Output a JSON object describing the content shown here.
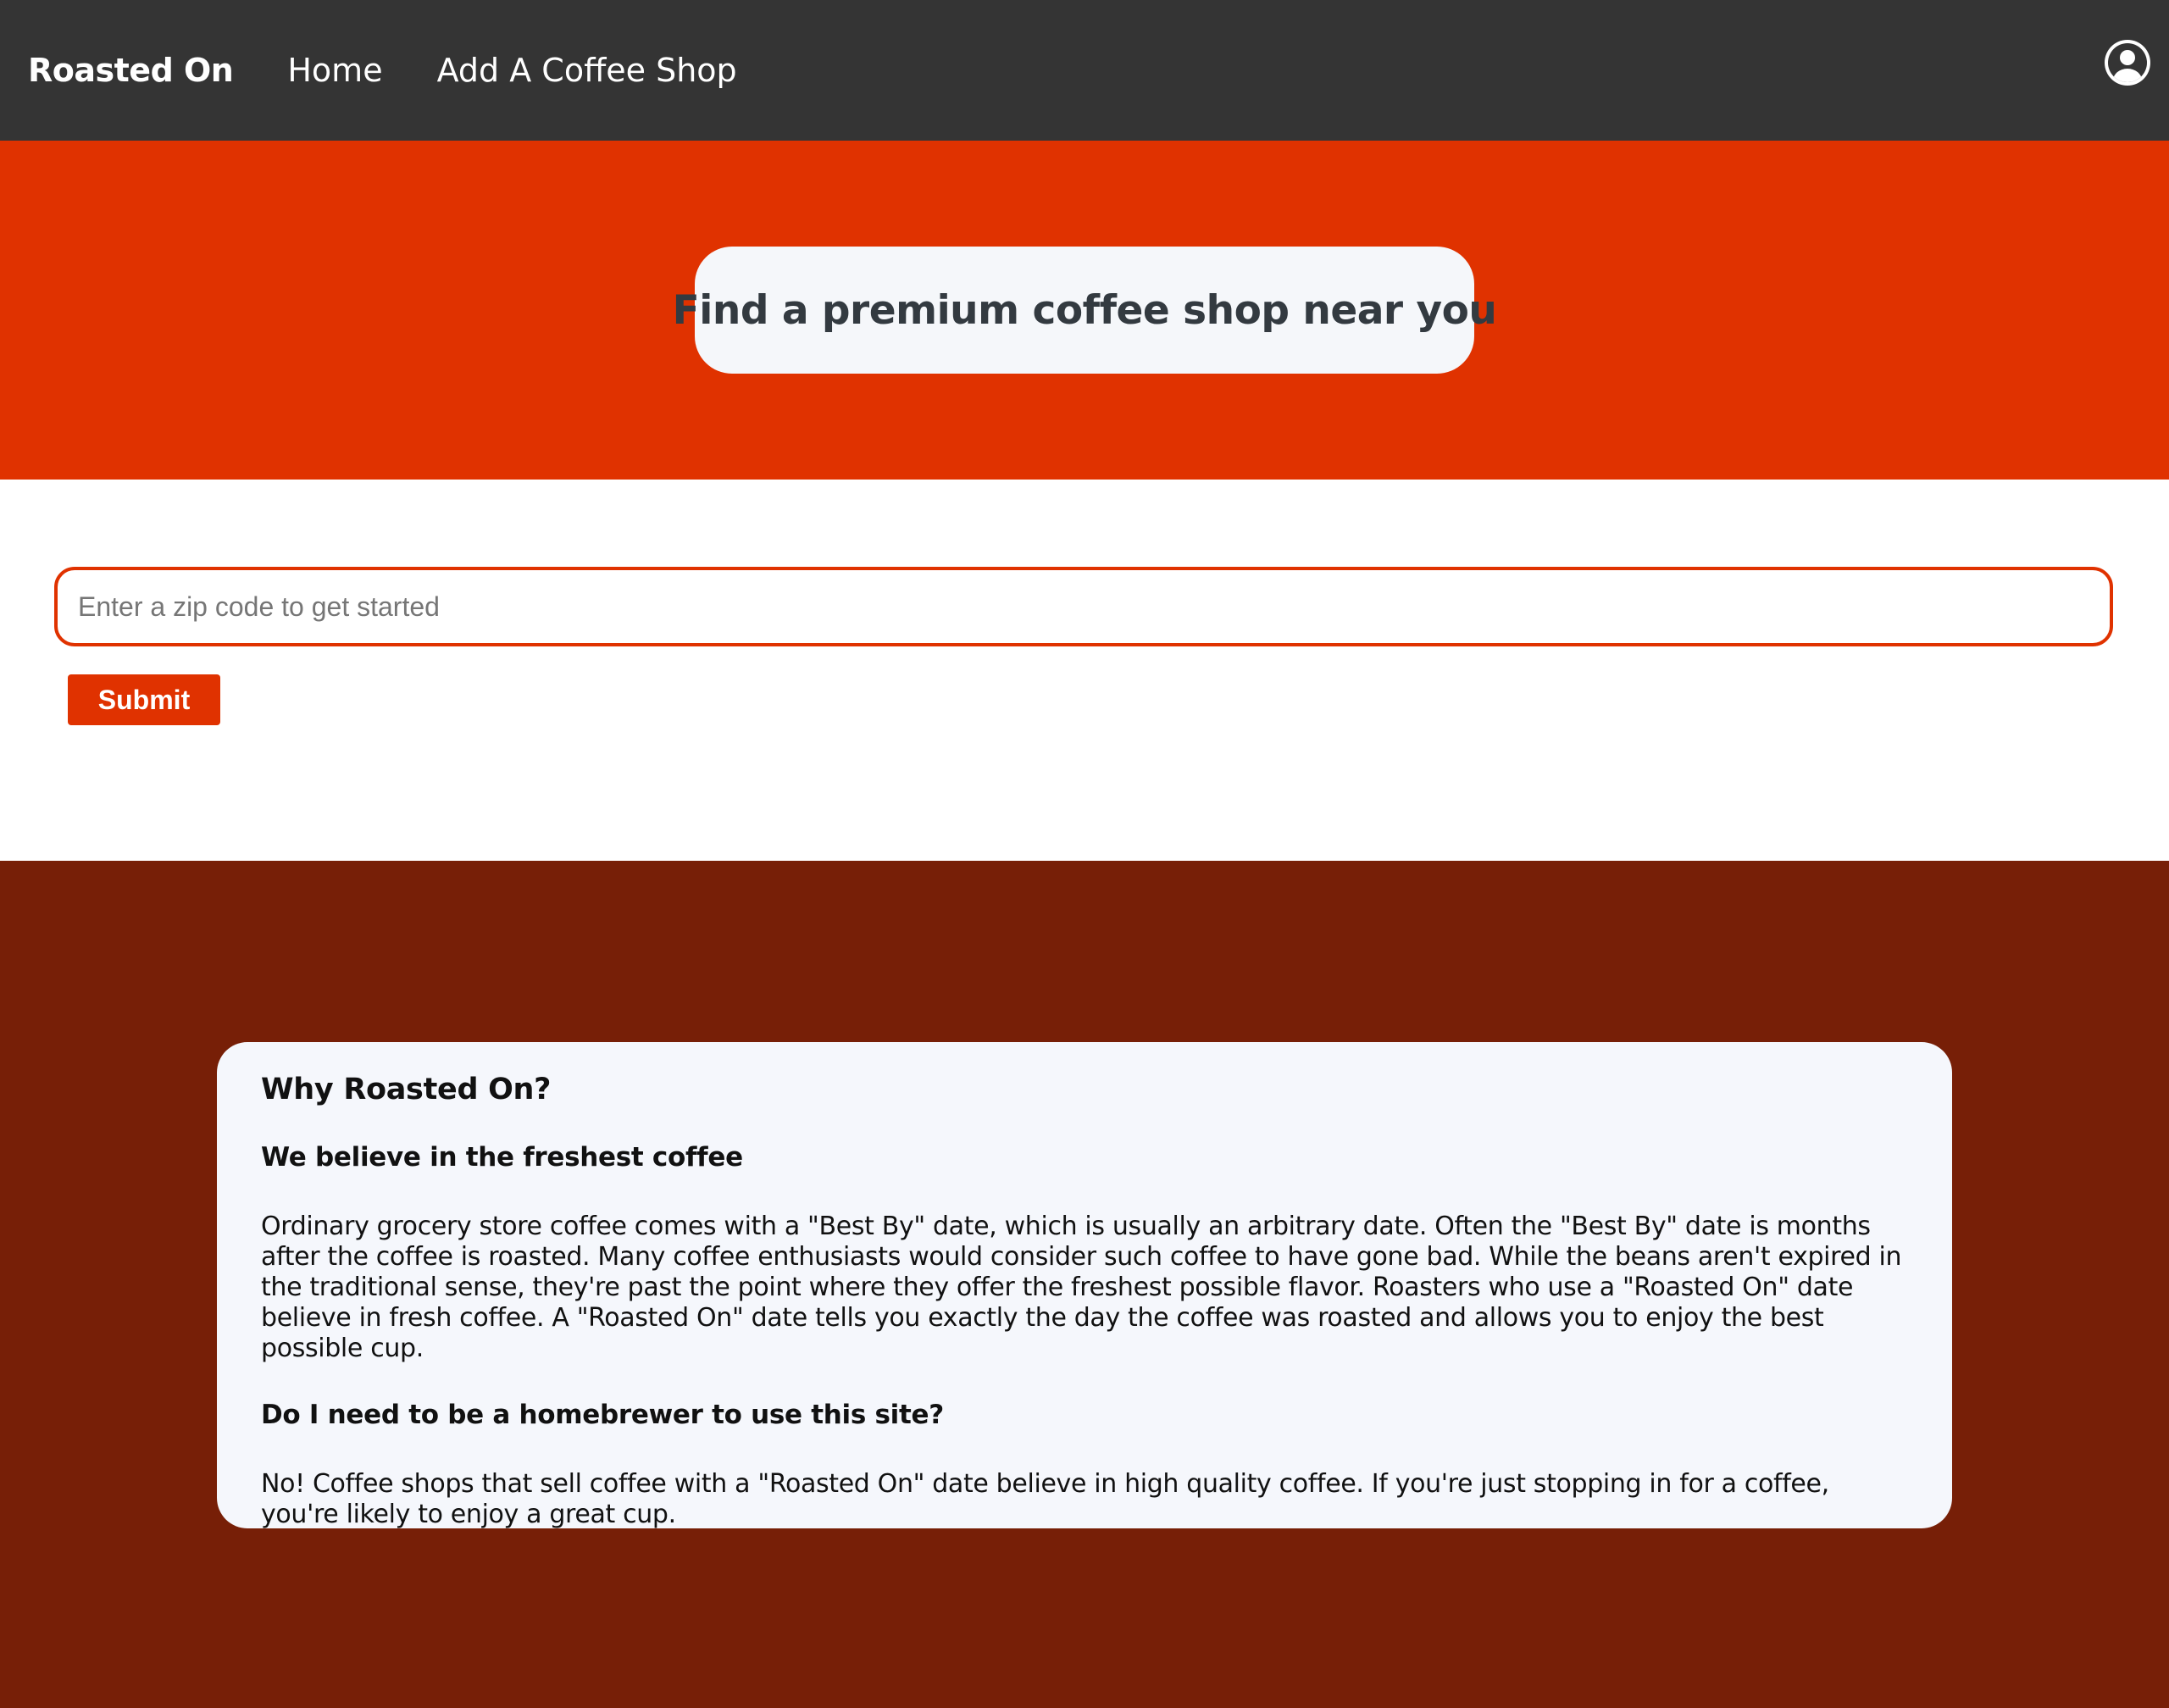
{
  "navbar": {
    "brand": "Roasted On",
    "links": [
      "Home",
      "Add A Coffee Shop"
    ],
    "account_icon": "account-circle-icon"
  },
  "hero": {
    "title": "Find a premium coffee shop near you"
  },
  "search": {
    "placeholder": "Enter a zip code to get started",
    "value": "",
    "submit_label": "Submit"
  },
  "info": {
    "title": "Why Roasted On?",
    "sections": [
      {
        "heading": "We believe in the freshest coffee",
        "body": "Ordinary grocery store coffee comes with a \"Best By\" date, which is usually an arbitrary date. Often the \"Best By\" date is months after the coffee is roasted. Many coffee enthusiasts would consider such coffee to have gone bad. While the beans aren't expired in the traditional sense, they're past the point where they offer the freshest possible flavor. Roasters who use a \"Roasted On\" date believe in fresh coffee. A \"Roasted On\" date tells you exactly the day the coffee was roasted and allows you to enjoy the best possible cup."
      },
      {
        "heading": "Do I need to be a homebrewer to use this site?",
        "body": "No! Coffee shops that sell coffee with a \"Roasted On\" date believe in high quality coffee. If you're just stopping in for a coffee, you're likely to enjoy a great cup."
      }
    ]
  },
  "colors": {
    "navbar": "#343434",
    "accent": "#e03200",
    "footer_bg": "#771f07",
    "card_bg": "#f5f7fc"
  }
}
